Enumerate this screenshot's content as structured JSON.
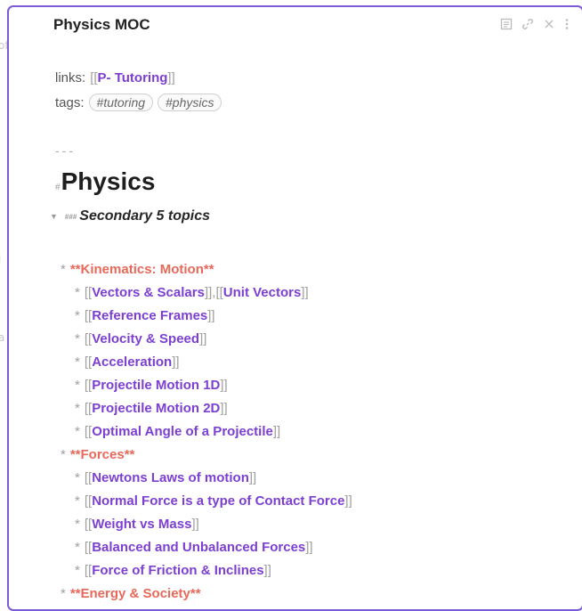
{
  "pane": {
    "title": "Physics MOC",
    "actions": [
      "reading-view-icon",
      "link-icon",
      "close-icon",
      "more-options-icon"
    ]
  },
  "gutter": {
    "glyphs": [
      "of",
      "i",
      "a"
    ]
  },
  "frontmatter": {
    "links_label": "links:",
    "links": [
      "P- Tutoring"
    ],
    "tags_label": "tags:",
    "tags": [
      "#tutoring",
      "#physics"
    ]
  },
  "doc": {
    "hr": "---",
    "h1_marker": "#",
    "h1": "Physics",
    "h3_marker": "###",
    "h3": "Secondary 5 topics"
  },
  "outline": [
    {
      "type": "section",
      "text": "**Kinematics: Motion**"
    },
    {
      "type": "links",
      "links": [
        "Vectors & Scalars",
        "Unit Vectors"
      ]
    },
    {
      "type": "links",
      "links": [
        "Reference Frames"
      ]
    },
    {
      "type": "links",
      "links": [
        "Velocity & Speed"
      ]
    },
    {
      "type": "links",
      "links": [
        "Acceleration"
      ]
    },
    {
      "type": "links",
      "links": [
        "Projectile Motion 1D"
      ]
    },
    {
      "type": "links",
      "links": [
        "Projectile Motion 2D"
      ]
    },
    {
      "type": "links",
      "links": [
        "Optimal Angle of a Projectile"
      ]
    },
    {
      "type": "section",
      "text": "**Forces**"
    },
    {
      "type": "links",
      "links": [
        "Newtons Laws of motion"
      ]
    },
    {
      "type": "links",
      "links": [
        "Normal Force is a type of Contact Force"
      ]
    },
    {
      "type": "links",
      "links": [
        "Weight vs Mass"
      ]
    },
    {
      "type": "links",
      "links": [
        "Balanced and Unbalanced Forces"
      ]
    },
    {
      "type": "links",
      "links": [
        "Force of Friction & Inclines"
      ]
    },
    {
      "type": "section",
      "text": "**Energy & Society**"
    }
  ],
  "colors": {
    "accent": "#7b5ad6",
    "link": "#7c3fd1",
    "section": "#e8695a"
  }
}
